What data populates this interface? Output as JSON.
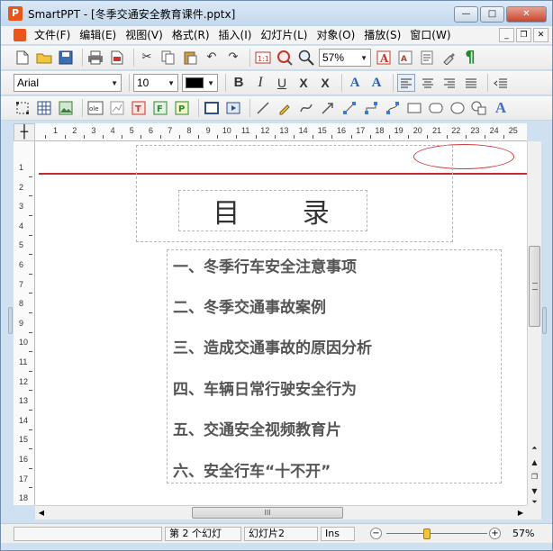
{
  "window": {
    "title": "SmartPPT - [冬季交通安全教育课件.pptx]",
    "app_icon": "P",
    "controls": {
      "minimize": "—",
      "maximize": "□",
      "close": "✕"
    }
  },
  "menubar": {
    "items": [
      "文件(F)",
      "编辑(E)",
      "视图(V)",
      "格式(R)",
      "插入(I)",
      "幻灯片(L)",
      "对象(O)",
      "播放(S)",
      "窗口(W)"
    ],
    "mdi_controls": {
      "minimize": "_",
      "restore": "❐",
      "close": "✕"
    }
  },
  "toolbar_standard": {
    "zoom_value": "57%",
    "icons": {
      "text_color": "A",
      "align_left_text": "¶"
    }
  },
  "toolbar_format": {
    "font_name": "Arial",
    "font_size": "10",
    "font_color": "#000000",
    "bold": "B",
    "italic": "I",
    "underline": "U",
    "strikethrough": "X",
    "double_strike": "X",
    "grow_font": "A",
    "shrink_font": "A"
  },
  "toolbar_draw": {
    "text_art_label": "A"
  },
  "ruler": {
    "corner_icon": "┼",
    "h_numbers": [
      "1",
      "2",
      "3",
      "4",
      "5",
      "6",
      "7",
      "8",
      "9",
      "10",
      "11",
      "12",
      "13",
      "14",
      "15",
      "16",
      "17",
      "18",
      "19",
      "20",
      "21",
      "22",
      "23",
      "24",
      "25"
    ],
    "v_numbers": [
      "1",
      "2",
      "3",
      "4",
      "5",
      "6",
      "7",
      "8",
      "9",
      "10",
      "11",
      "12",
      "13",
      "14",
      "15",
      "16",
      "17",
      "18"
    ]
  },
  "slide": {
    "title": "目 录",
    "toc": [
      "一、冬季行车安全注意事项",
      "二、冬季交通事故案例",
      "三、造成交通事故的原因分析",
      "四、车辆日常行驶安全行为",
      "五、交通安全视频教育片",
      "六、安全行车“十不开”"
    ],
    "colors": {
      "accent_line": "#c12d2d",
      "oval": "#d23a3a",
      "text": "#555555"
    }
  },
  "scrollbars": {
    "h_thumb_label": "III",
    "v_controls": {
      "first": "⏶",
      "prev": "▲",
      "window": "❐",
      "next": "▼",
      "last": "⏷"
    }
  },
  "statusbar": {
    "slide_position": "第 2 个幻灯",
    "slide_name": "幻灯片2",
    "insert_mode": "Ins",
    "zoom_minus": "−",
    "zoom_plus": "+",
    "zoom_level": "57%",
    "zoom_fraction": 0.4
  }
}
